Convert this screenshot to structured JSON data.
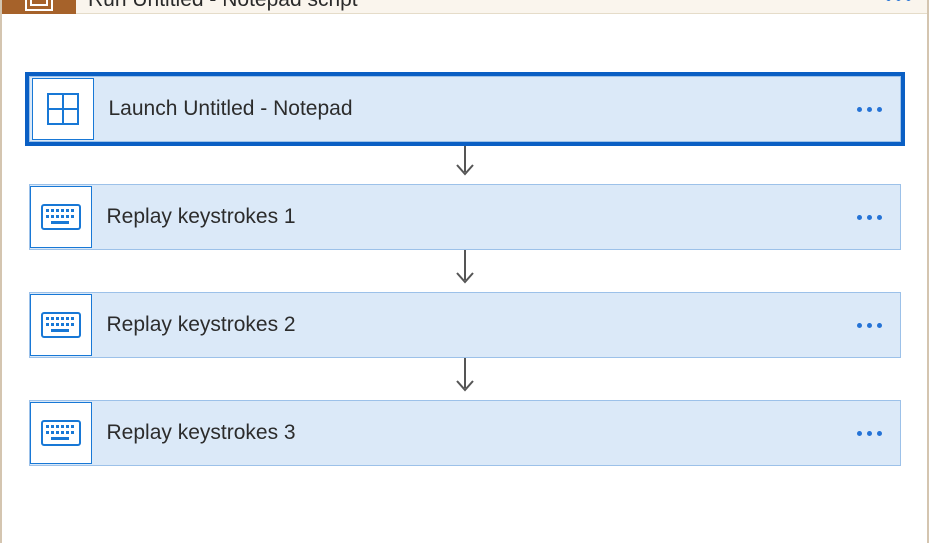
{
  "header": {
    "title": "Run Untitled - Notepad script",
    "icon": "script-icon"
  },
  "steps": [
    {
      "label": "Launch Untitled - Notepad",
      "icon": "window-icon",
      "selected": true
    },
    {
      "label": "Replay keystrokes 1",
      "icon": "keyboard-icon",
      "selected": false
    },
    {
      "label": "Replay keystrokes 2",
      "icon": "keyboard-icon",
      "selected": false
    },
    {
      "label": "Replay keystrokes 3",
      "icon": "keyboard-icon",
      "selected": false
    }
  ],
  "colors": {
    "primary": "#0a5fc4",
    "stepBg": "#dbe9f8",
    "stepBorder": "#9cc1e9",
    "headerBg": "#faf5ed",
    "headerIconBg": "#a6622a"
  }
}
